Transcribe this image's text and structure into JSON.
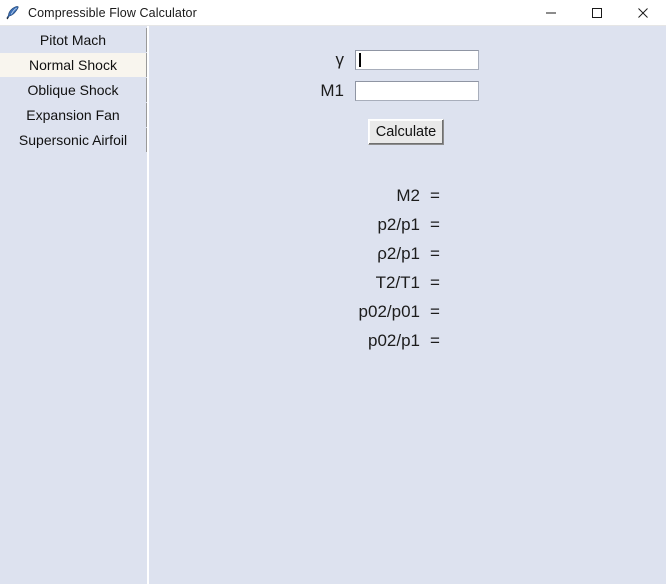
{
  "window": {
    "title": "Compressible Flow Calculator",
    "icon": "feather-icon",
    "controls": {
      "minimize": "minimize-icon",
      "maximize": "maximize-icon",
      "close": "close-icon"
    },
    "colors": {
      "titlebar_background": "#ffffff",
      "app_background": "#dde2ef",
      "selected_tab_background": "#f8f5ee",
      "input_background": "#ffffff",
      "button_face": "#e9e9e9",
      "text": "#1c1c1c",
      "divider": "#ffffff"
    }
  },
  "sidebar": {
    "items": [
      {
        "label": "Pitot Mach",
        "selected": false
      },
      {
        "label": "Normal Shock",
        "selected": true
      },
      {
        "label": "Oblique Shock",
        "selected": false
      },
      {
        "label": "Expansion Fan",
        "selected": false
      },
      {
        "label": "Supersonic Airfoil",
        "selected": false
      }
    ]
  },
  "main": {
    "inputs": [
      {
        "label": "γ",
        "value": "",
        "placeholder": "",
        "focused": true
      },
      {
        "label": "M1",
        "value": "",
        "placeholder": "",
        "focused": false
      }
    ],
    "calculate_button": "Calculate",
    "results": [
      {
        "label": "M2",
        "equals": "=",
        "value": ""
      },
      {
        "label": "p2/p1",
        "equals": "=",
        "value": ""
      },
      {
        "label": "ρ2/p1",
        "equals": "=",
        "value": ""
      },
      {
        "label": "T2/T1",
        "equals": "=",
        "value": ""
      },
      {
        "label": "p02/p01",
        "equals": "=",
        "value": ""
      },
      {
        "label": "p02/p1",
        "equals": "=",
        "value": ""
      }
    ]
  }
}
